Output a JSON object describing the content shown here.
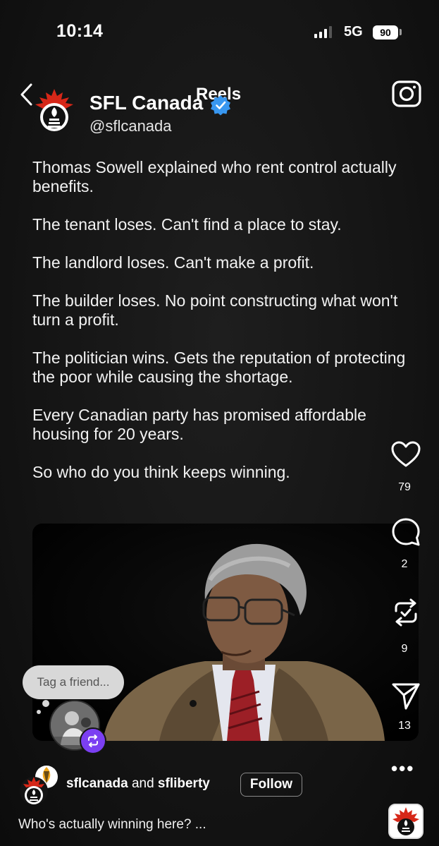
{
  "status_bar": {
    "time": "10:14",
    "network": "5G",
    "battery": "90"
  },
  "header": {
    "title": "Reels",
    "back_icon": "chevron-left-icon",
    "camera_icon": "camera-icon"
  },
  "post": {
    "display_name": "SFL Canada",
    "handle": "@sflcanada",
    "verified": true,
    "caption": [
      "Thomas Sowell explained who rent control actually benefits.",
      "The tenant loses. Can't find a place to stay.",
      "The landlord loses. Can't make a profit.",
      "The builder loses. No point constructing what won't turn a profit.",
      "The politician wins. Gets the reputation of protecting the poor while causing the shortage.",
      "Every Canadian party has promised affordable housing for 20 years.",
      "So who do you think keeps winning."
    ]
  },
  "actions": {
    "likes": "79",
    "comments": "2",
    "reposts": "9",
    "shares": "13"
  },
  "tag_prompt": "Tag a friend...",
  "footer": {
    "author_1": "sflcanada",
    "connector": "and",
    "author_2": "sfliberty",
    "follow_label": "Follow",
    "caption_preview": "Who's actually winning here? ...",
    "more_icon": "ellipsis-icon"
  },
  "colors": {
    "background": "#141414",
    "verified_badge": "#3897f0",
    "logo_red": "#d62718",
    "remix_purple": "#7b3ff2"
  }
}
